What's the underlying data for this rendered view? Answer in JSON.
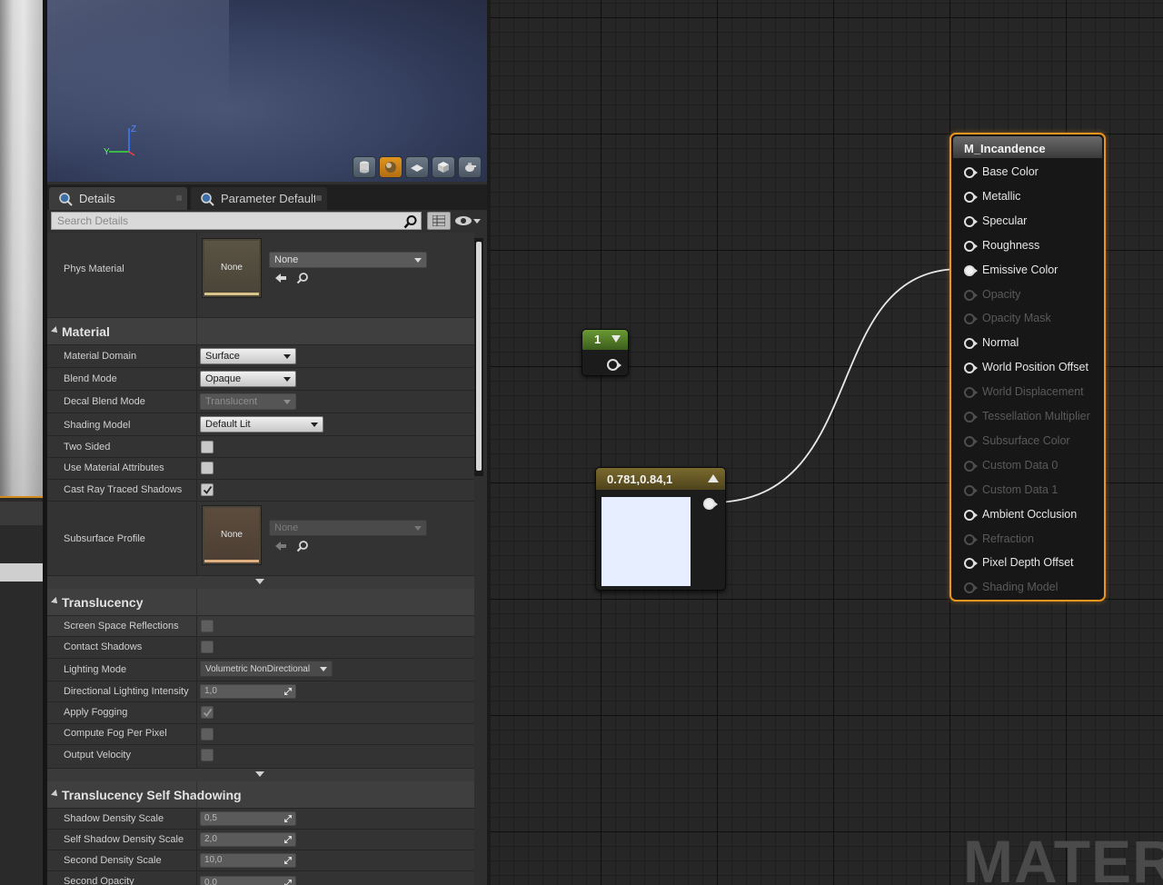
{
  "tabs": {
    "details": "Details",
    "parameter_defaults": "Parameter Defaults"
  },
  "search": {
    "placeholder": "Search Details"
  },
  "phys_material": {
    "label": "Phys Material",
    "thumb": "None",
    "combo": "None"
  },
  "material": {
    "title": "Material",
    "domain": {
      "label": "Material Domain",
      "value": "Surface"
    },
    "blend": {
      "label": "Blend Mode",
      "value": "Opaque"
    },
    "decal_blend": {
      "label": "Decal Blend Mode",
      "value": "Translucent"
    },
    "shading": {
      "label": "Shading Model",
      "value": "Default Lit"
    },
    "two_sided": {
      "label": "Two Sided",
      "checked": false
    },
    "use_attrs": {
      "label": "Use Material Attributes",
      "checked": false
    },
    "cast_rt": {
      "label": "Cast Ray Traced Shadows",
      "checked": true
    },
    "subsurface": {
      "label": "Subsurface Profile",
      "thumb": "None",
      "combo": "None"
    }
  },
  "translucency": {
    "title": "Translucency",
    "ssr": {
      "label": "Screen Space Reflections",
      "checked": false
    },
    "contact": {
      "label": "Contact Shadows",
      "checked": false
    },
    "lighting_mode": {
      "label": "Lighting Mode",
      "value": "Volumetric NonDirectional"
    },
    "dir_light": {
      "label": "Directional Lighting Intensity",
      "value": "1,0"
    },
    "fog": {
      "label": "Apply Fogging",
      "checked": true
    },
    "fog_pixel": {
      "label": "Compute Fog Per Pixel",
      "checked": false
    },
    "velocity": {
      "label": "Output Velocity",
      "checked": false
    }
  },
  "self_shadow": {
    "title": "Translucency Self Shadowing",
    "shadow_density": {
      "label": "Shadow Density Scale",
      "value": "0,5"
    },
    "self_density": {
      "label": "Self Shadow Density Scale",
      "value": "2,0"
    },
    "second_density": {
      "label": "Second Density Scale",
      "value": "10,0"
    },
    "second_opacity": {
      "label": "Second Opacity",
      "value": "0,0"
    }
  },
  "graph": {
    "const_node": {
      "value": "1"
    },
    "vector_node": {
      "title": "0.781,0.84,1",
      "color": "#e6eeff"
    },
    "material_node": {
      "title": "M_Incandence",
      "pins": [
        {
          "label": "Base Color",
          "enabled": true,
          "connected": false
        },
        {
          "label": "Metallic",
          "enabled": true,
          "connected": false
        },
        {
          "label": "Specular",
          "enabled": true,
          "connected": false
        },
        {
          "label": "Roughness",
          "enabled": true,
          "connected": false
        },
        {
          "label": "Emissive Color",
          "enabled": true,
          "connected": true
        },
        {
          "label": "Opacity",
          "enabled": false,
          "connected": false
        },
        {
          "label": "Opacity Mask",
          "enabled": false,
          "connected": false
        },
        {
          "label": "Normal",
          "enabled": true,
          "connected": false
        },
        {
          "label": "World Position Offset",
          "enabled": true,
          "connected": false
        },
        {
          "label": "World Displacement",
          "enabled": false,
          "connected": false
        },
        {
          "label": "Tessellation Multiplier",
          "enabled": false,
          "connected": false
        },
        {
          "label": "Subsurface Color",
          "enabled": false,
          "connected": false
        },
        {
          "label": "Custom Data 0",
          "enabled": false,
          "connected": false
        },
        {
          "label": "Custom Data 1",
          "enabled": false,
          "connected": false
        },
        {
          "label": "Ambient Occlusion",
          "enabled": true,
          "connected": false
        },
        {
          "label": "Refraction",
          "enabled": false,
          "connected": false
        },
        {
          "label": "Pixel Depth Offset",
          "enabled": true,
          "connected": false
        },
        {
          "label": "Shading Model",
          "enabled": false,
          "connected": false
        }
      ]
    },
    "watermark": "MATERIAL"
  },
  "colors": {
    "accent": "#e8961e",
    "selected_node_border": "#e8961e"
  }
}
